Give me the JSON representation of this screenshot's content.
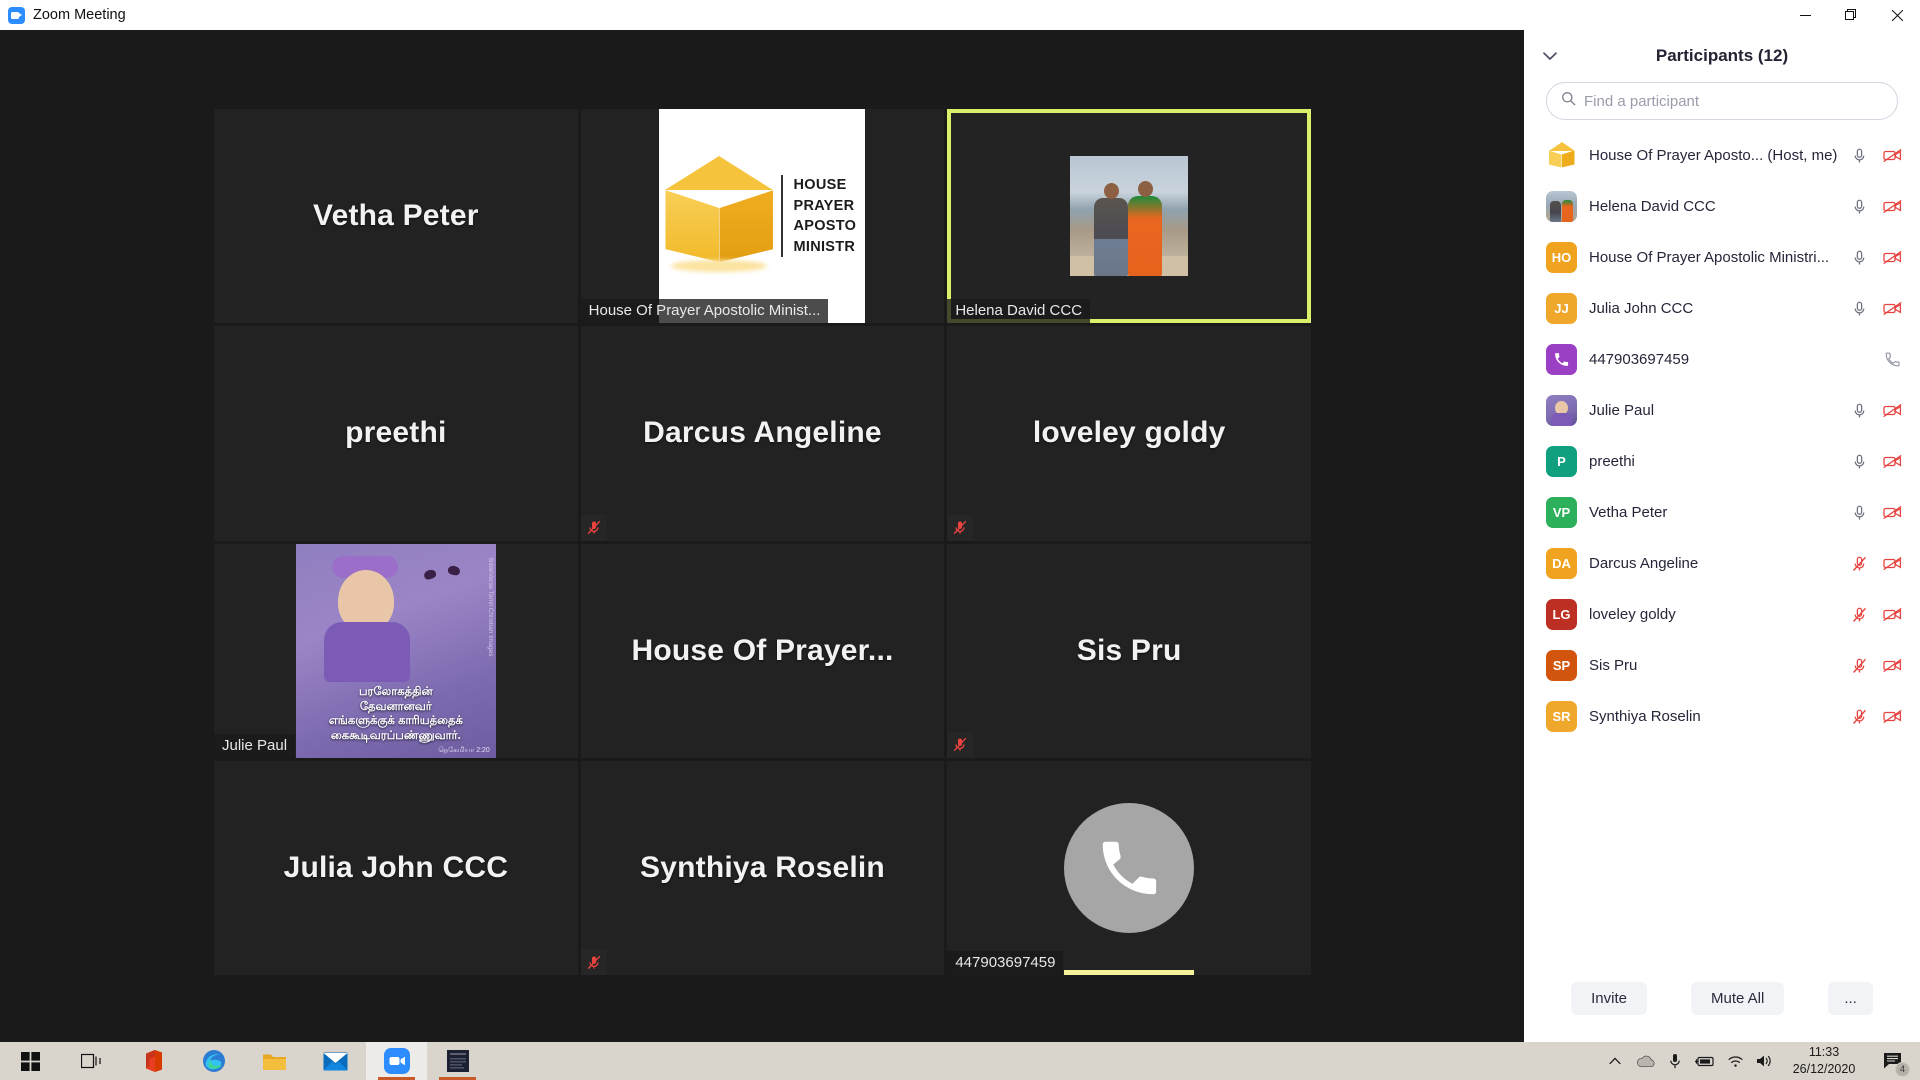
{
  "window": {
    "title": "Zoom Meeting",
    "app_icon": "zoom-icon",
    "controls": {
      "minimize": "minimize-icon",
      "restore": "restore-icon",
      "close": "close-icon"
    }
  },
  "gallery": {
    "tiles": [
      {
        "name": "Vetha Peter",
        "display": "name",
        "label": "",
        "muted": false,
        "active": false,
        "speaking": false
      },
      {
        "name": "House Of Prayer Apostolic Minist...",
        "display": "logo",
        "label": "House Of Prayer Apostolic Minist...",
        "muted": false,
        "active": false,
        "speaking": false,
        "logo_lines": [
          "HOUSE",
          "PRAYER",
          "APOSTO",
          "MINISTR"
        ]
      },
      {
        "name": "Helena David CCC",
        "display": "photo-couple",
        "label": "Helena David CCC",
        "muted": false,
        "active": true,
        "speaking": false
      },
      {
        "name": "preethi",
        "display": "name",
        "label": "",
        "muted": false,
        "active": false,
        "speaking": false
      },
      {
        "name": "Darcus Angeline",
        "display": "name",
        "label": "",
        "muted": true,
        "active": false,
        "speaking": false
      },
      {
        "name": "loveley goldy",
        "display": "name",
        "label": "",
        "muted": true,
        "active": false,
        "speaking": false
      },
      {
        "name": "Julie Paul",
        "display": "photo-verse",
        "label": "Julie Paul",
        "muted": false,
        "active": false,
        "speaking": false,
        "verse_lines": [
          "பரலோகத்தின்",
          "தேவனானவர்",
          "எங்களுக்குக் காரியத்தைக்",
          "கைகூடிவரப்பண்ணுவார்."
        ],
        "verse_ref": "நெகேமியா 2:20",
        "verse_credit": "BibleVerse Tamil Christian Images"
      },
      {
        "name": "House Of Prayer...",
        "display": "name",
        "label": "",
        "muted": false,
        "active": false,
        "speaking": false
      },
      {
        "name": "Sis Pru",
        "display": "name",
        "label": "",
        "muted": true,
        "active": false,
        "speaking": false
      },
      {
        "name": "Julia John CCC",
        "display": "name",
        "label": "",
        "muted": false,
        "active": false,
        "speaking": false
      },
      {
        "name": "Synthiya Roselin",
        "display": "name",
        "label": "",
        "muted": true,
        "active": false,
        "speaking": false
      },
      {
        "name": "447903697459",
        "display": "phone",
        "label": "447903697459",
        "muted": false,
        "active": false,
        "speaking": true
      }
    ]
  },
  "panel": {
    "collapse_icon": "chevron-down-icon",
    "title": "Participants (12)",
    "search": {
      "placeholder": "Find a participant",
      "value": "",
      "icon": "search-icon"
    },
    "participants": [
      {
        "name": "House Of Prayer Aposto... (Host, me)",
        "avatar_type": "cube",
        "avatar_initials": "",
        "avatar_color": "#f6c33c",
        "mic": "unmuted",
        "video": "off"
      },
      {
        "name": "Helena David CCC",
        "avatar_type": "photo-couple",
        "avatar_initials": "",
        "avatar_color": "#98a8b6",
        "mic": "unmuted",
        "video": "off"
      },
      {
        "name": "House Of Prayer Apostolic Ministri...",
        "avatar_type": "initials",
        "avatar_initials": "HO",
        "avatar_color": "#f0a31e",
        "mic": "unmuted",
        "video": "off"
      },
      {
        "name": "Julia John CCC",
        "avatar_type": "initials",
        "avatar_initials": "JJ",
        "avatar_color": "#f0a82c",
        "mic": "unmuted",
        "video": "off"
      },
      {
        "name": "447903697459",
        "avatar_type": "phone",
        "avatar_initials": "",
        "avatar_color": "#9b3fc4",
        "mic": "phone",
        "video": "none"
      },
      {
        "name": "Julie Paul",
        "avatar_type": "photo-verse",
        "avatar_initials": "",
        "avatar_color": "#7d6bb0",
        "mic": "unmuted",
        "video": "off"
      },
      {
        "name": "preethi",
        "avatar_type": "initials",
        "avatar_initials": "P",
        "avatar_color": "#11a07f",
        "mic": "unmuted",
        "video": "off"
      },
      {
        "name": "Vetha Peter",
        "avatar_type": "initials",
        "avatar_initials": "VP",
        "avatar_color": "#2cb05c",
        "mic": "unmuted",
        "video": "off"
      },
      {
        "name": "Darcus Angeline",
        "avatar_type": "initials",
        "avatar_initials": "DA",
        "avatar_color": "#f0a31e",
        "mic": "muted",
        "video": "off"
      },
      {
        "name": "loveley goldy",
        "avatar_type": "initials",
        "avatar_initials": "LG",
        "avatar_color": "#bc2f22",
        "mic": "muted",
        "video": "off"
      },
      {
        "name": "Sis Pru",
        "avatar_type": "initials",
        "avatar_initials": "SP",
        "avatar_color": "#d2550d",
        "mic": "muted",
        "video": "off"
      },
      {
        "name": "Synthiya Roselin",
        "avatar_type": "initials",
        "avatar_initials": "SR",
        "avatar_color": "#f0a82c",
        "mic": "muted",
        "video": "off"
      }
    ],
    "footer": {
      "invite": "Invite",
      "mute_all": "Mute All",
      "more": "..."
    }
  },
  "taskbar": {
    "apps": [
      {
        "name": "start-button",
        "icon": "windows-icon",
        "active": false,
        "running": false
      },
      {
        "name": "task-view-button",
        "icon": "task-view-icon",
        "active": false,
        "running": false
      },
      {
        "name": "office-button",
        "icon": "office-icon",
        "active": false,
        "running": false
      },
      {
        "name": "edge-button",
        "icon": "edge-icon",
        "active": false,
        "running": true
      },
      {
        "name": "file-explorer-button",
        "icon": "folder-icon",
        "active": false,
        "running": false
      },
      {
        "name": "mail-button",
        "icon": "mail-icon",
        "active": false,
        "running": false
      },
      {
        "name": "zoom-button",
        "icon": "zoom-icon",
        "active": true,
        "running": true
      },
      {
        "name": "photos-window-button",
        "icon": "image-thumbnail-icon",
        "active": false,
        "running": true
      }
    ],
    "tray": [
      "show-hidden-icons",
      "onedrive-icon",
      "microphone-icon",
      "battery-icon",
      "wifi-icon",
      "volume-icon"
    ],
    "clock": {
      "time": "11:33",
      "date": "26/12/2020"
    },
    "notifications": {
      "icon": "action-center-icon",
      "count": "4"
    }
  },
  "colors": {
    "accent_active_tile": "#d9f06a",
    "speaking_bar": "#f4f39a",
    "mute_red": "#e8433f",
    "panel_bg": "#ffffff",
    "gallery_bg": "#1a1a1a",
    "taskbar_bg": "#d9d4cc"
  }
}
